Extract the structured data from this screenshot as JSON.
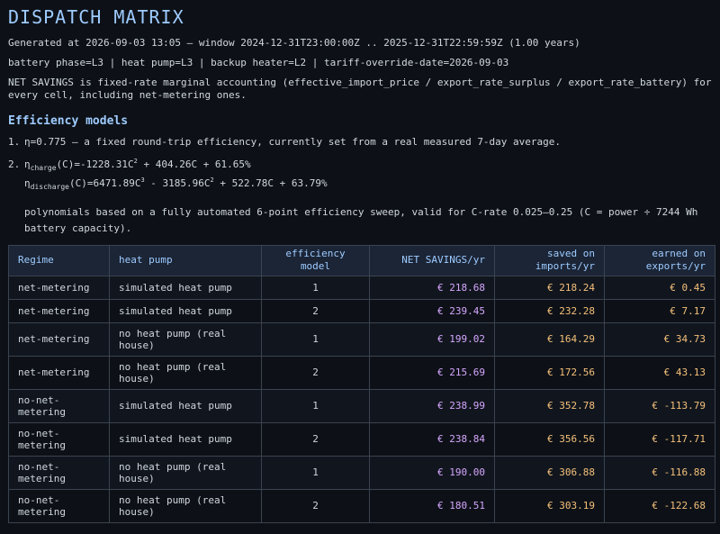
{
  "title": "DISPATCH MATRIX",
  "generated_line": "Generated at 2026-09-03 13:05 — window 2024-12-31T23:00:00Z .. 2025-12-31T22:59:59Z (1.00 years)",
  "config_line": "battery phase=L3 | heat pump=L3 | backup heater=L2 | tariff-override-date=2026-09-03",
  "net_savings_note": "NET SAVINGS is fixed-rate marginal accounting (effective_import_price / export_rate_surplus / export_rate_battery) for every cell, including net-metering ones.",
  "efficiency_heading": "Efficiency models",
  "models": {
    "m1_num": "1.",
    "m1_text": "η=0.775 — a fixed round-trip efficiency, currently set from a real measured 7-day average.",
    "m2_num": "2.",
    "eta": "η",
    "charge_sub": "charge",
    "charge_a": "(C)=-1228.31C",
    "charge_exp": "2",
    "charge_b": " + 404.26C + 61.65%",
    "discharge_sub": "discharge",
    "discharge_a": "(C)=6471.89C",
    "discharge_exp1": "3",
    "discharge_b": " - 3185.96C",
    "discharge_exp2": "2",
    "discharge_c": " + 522.78C + 63.79%",
    "poly_note": "polynomials based on a fully automated 6-point efficiency sweep, valid for C-rate 0.025–0.25 (C = power ÷ 7244 Wh battery capacity)."
  },
  "table": {
    "headers": {
      "regime": "Regime",
      "heat_pump": "heat pump",
      "efficiency_model": "efficiency model",
      "net_savings": "NET SAVINGS/yr",
      "saved_on_imports": "saved on imports/yr",
      "earned_on_exports": "earned on exports/yr"
    },
    "rows": [
      {
        "regime": "net-metering",
        "heat_pump": "simulated heat pump",
        "model": "1",
        "net": "€ 218.68",
        "saved": "€ 218.24",
        "earned": "€ 0.45"
      },
      {
        "regime": "net-metering",
        "heat_pump": "simulated heat pump",
        "model": "2",
        "net": "€ 239.45",
        "saved": "€ 232.28",
        "earned": "€ 7.17"
      },
      {
        "regime": "net-metering",
        "heat_pump": "no heat pump (real house)",
        "model": "1",
        "net": "€ 199.02",
        "saved": "€ 164.29",
        "earned": "€ 34.73"
      },
      {
        "regime": "net-metering",
        "heat_pump": "no heat pump (real house)",
        "model": "2",
        "net": "€ 215.69",
        "saved": "€ 172.56",
        "earned": "€ 43.13"
      },
      {
        "regime": "no-net-metering",
        "heat_pump": "simulated heat pump",
        "model": "1",
        "net": "€ 238.99",
        "saved": "€ 352.78",
        "earned": "€ -113.79"
      },
      {
        "regime": "no-net-metering",
        "heat_pump": "simulated heat pump",
        "model": "2",
        "net": "€ 238.84",
        "saved": "€ 356.56",
        "earned": "€ -117.71"
      },
      {
        "regime": "no-net-metering",
        "heat_pump": "no heat pump (real house)",
        "model": "1",
        "net": "€ 190.00",
        "saved": "€ 306.88",
        "earned": "€ -116.88"
      },
      {
        "regime": "no-net-metering",
        "heat_pump": "no heat pump (real house)",
        "model": "2",
        "net": "€ 180.51",
        "saved": "€ 303.19",
        "earned": "€ -122.68"
      }
    ]
  }
}
